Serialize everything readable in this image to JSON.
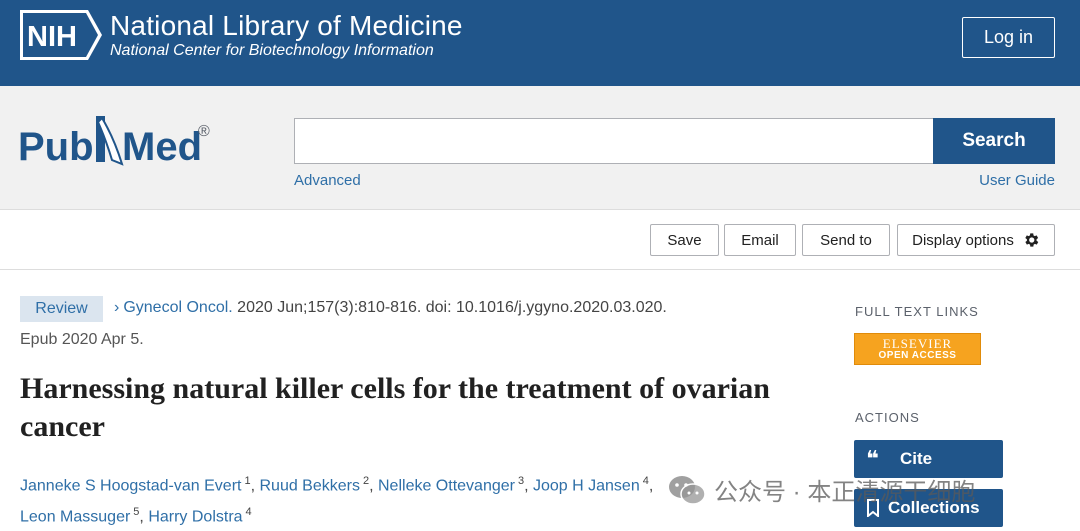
{
  "header": {
    "logo_text": "NIH",
    "title": "National Library of Medicine",
    "subtitle": "National Center for Biotechnology Information",
    "login_label": "Log in",
    "brand_color": "#20558a"
  },
  "search": {
    "logo_text": "PubMed",
    "logo_mark": "®",
    "query": "",
    "button_label": "Search",
    "advanced_label": "Advanced",
    "user_guide_label": "User Guide"
  },
  "toolbar": {
    "save_label": "Save",
    "email_label": "Email",
    "send_to_label": "Send to",
    "display_options_label": "Display options",
    "display_icon": "gear-icon"
  },
  "article": {
    "type_badge": "Review",
    "journal": "Gynecol Oncol.",
    "citation": "2020 Jun;157(3):810-816. doi: 10.1016/j.ygyno.2020.03.020.",
    "epub": "Epub 2020 Apr 5.",
    "title": "Harnessing natural killer cells for the treatment of ovarian cancer",
    "authors": [
      {
        "name": "Janneke S Hoogstad-van Evert",
        "aff": "1"
      },
      {
        "name": "Ruud Bekkers",
        "aff": "2"
      },
      {
        "name": "Nelleke Ottevanger",
        "aff": "3"
      },
      {
        "name": "Joop H Jansen",
        "aff": "4"
      },
      {
        "name": "Leon Massuger",
        "aff": "5"
      },
      {
        "name": "Harry Dolstra",
        "aff": "4"
      }
    ]
  },
  "sidebar": {
    "full_text_heading": "FULL TEXT LINKS",
    "publisher_name": "ELSEVIER",
    "publisher_access": "OPEN ACCESS",
    "actions_heading": "ACTIONS",
    "cite_label": "Cite",
    "collections_label": "Collections"
  },
  "watermark": {
    "text": "公众号 · 本正清源干细胞"
  }
}
